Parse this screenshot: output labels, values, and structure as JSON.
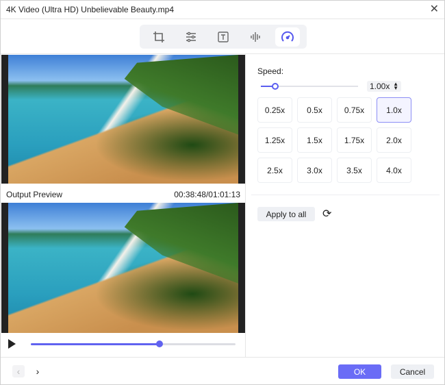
{
  "window": {
    "title": "4K Video (Ultra HD) Unbelievable Beauty.mp4",
    "close": "✕"
  },
  "toolbar": {
    "tools": [
      {
        "name": "crop"
      },
      {
        "name": "adjust"
      },
      {
        "name": "text"
      },
      {
        "name": "audio"
      },
      {
        "name": "speed",
        "active": true
      }
    ]
  },
  "preview": {
    "label": "Output Preview",
    "timecode": "00:38:48/01:01:13",
    "progress": 0.63
  },
  "speed": {
    "label": "Speed:",
    "value": "1.00x",
    "slider_fraction": 0.15,
    "options": [
      "0.25x",
      "0.5x",
      "0.75x",
      "1.0x",
      "1.25x",
      "1.5x",
      "1.75x",
      "2.0x",
      "2.5x",
      "3.0x",
      "3.5x",
      "4.0x"
    ],
    "selected": "1.0x",
    "apply_all": "Apply to all"
  },
  "footer": {
    "prev": "‹",
    "next": "›",
    "ok": "OK",
    "cancel": "Cancel"
  },
  "colors": {
    "accent": "#6a6cf6"
  }
}
